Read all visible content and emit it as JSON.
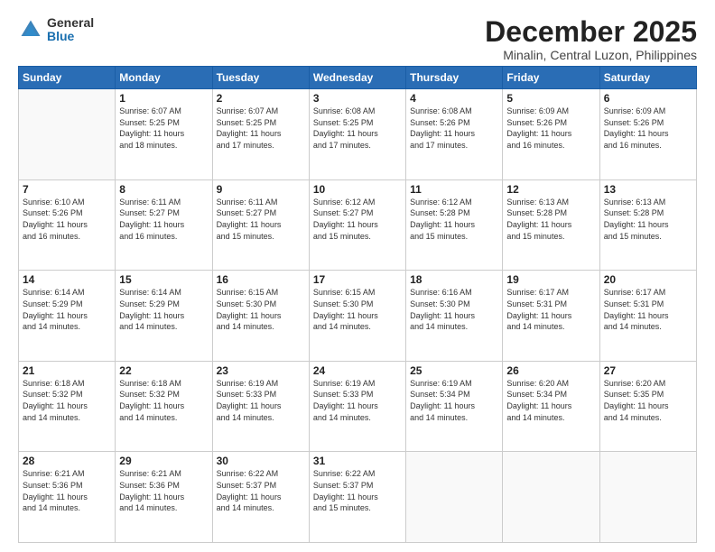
{
  "logo": {
    "general": "General",
    "blue": "Blue"
  },
  "title": "December 2025",
  "subtitle": "Minalin, Central Luzon, Philippines",
  "weekdays": [
    "Sunday",
    "Monday",
    "Tuesday",
    "Wednesday",
    "Thursday",
    "Friday",
    "Saturday"
  ],
  "weeks": [
    [
      {
        "day": "",
        "info": ""
      },
      {
        "day": "1",
        "info": "Sunrise: 6:07 AM\nSunset: 5:25 PM\nDaylight: 11 hours\nand 18 minutes."
      },
      {
        "day": "2",
        "info": "Sunrise: 6:07 AM\nSunset: 5:25 PM\nDaylight: 11 hours\nand 17 minutes."
      },
      {
        "day": "3",
        "info": "Sunrise: 6:08 AM\nSunset: 5:25 PM\nDaylight: 11 hours\nand 17 minutes."
      },
      {
        "day": "4",
        "info": "Sunrise: 6:08 AM\nSunset: 5:26 PM\nDaylight: 11 hours\nand 17 minutes."
      },
      {
        "day": "5",
        "info": "Sunrise: 6:09 AM\nSunset: 5:26 PM\nDaylight: 11 hours\nand 16 minutes."
      },
      {
        "day": "6",
        "info": "Sunrise: 6:09 AM\nSunset: 5:26 PM\nDaylight: 11 hours\nand 16 minutes."
      }
    ],
    [
      {
        "day": "7",
        "info": "Sunrise: 6:10 AM\nSunset: 5:26 PM\nDaylight: 11 hours\nand 16 minutes."
      },
      {
        "day": "8",
        "info": "Sunrise: 6:11 AM\nSunset: 5:27 PM\nDaylight: 11 hours\nand 16 minutes."
      },
      {
        "day": "9",
        "info": "Sunrise: 6:11 AM\nSunset: 5:27 PM\nDaylight: 11 hours\nand 15 minutes."
      },
      {
        "day": "10",
        "info": "Sunrise: 6:12 AM\nSunset: 5:27 PM\nDaylight: 11 hours\nand 15 minutes."
      },
      {
        "day": "11",
        "info": "Sunrise: 6:12 AM\nSunset: 5:28 PM\nDaylight: 11 hours\nand 15 minutes."
      },
      {
        "day": "12",
        "info": "Sunrise: 6:13 AM\nSunset: 5:28 PM\nDaylight: 11 hours\nand 15 minutes."
      },
      {
        "day": "13",
        "info": "Sunrise: 6:13 AM\nSunset: 5:28 PM\nDaylight: 11 hours\nand 15 minutes."
      }
    ],
    [
      {
        "day": "14",
        "info": "Sunrise: 6:14 AM\nSunset: 5:29 PM\nDaylight: 11 hours\nand 14 minutes."
      },
      {
        "day": "15",
        "info": "Sunrise: 6:14 AM\nSunset: 5:29 PM\nDaylight: 11 hours\nand 14 minutes."
      },
      {
        "day": "16",
        "info": "Sunrise: 6:15 AM\nSunset: 5:30 PM\nDaylight: 11 hours\nand 14 minutes."
      },
      {
        "day": "17",
        "info": "Sunrise: 6:15 AM\nSunset: 5:30 PM\nDaylight: 11 hours\nand 14 minutes."
      },
      {
        "day": "18",
        "info": "Sunrise: 6:16 AM\nSunset: 5:30 PM\nDaylight: 11 hours\nand 14 minutes."
      },
      {
        "day": "19",
        "info": "Sunrise: 6:17 AM\nSunset: 5:31 PM\nDaylight: 11 hours\nand 14 minutes."
      },
      {
        "day": "20",
        "info": "Sunrise: 6:17 AM\nSunset: 5:31 PM\nDaylight: 11 hours\nand 14 minutes."
      }
    ],
    [
      {
        "day": "21",
        "info": "Sunrise: 6:18 AM\nSunset: 5:32 PM\nDaylight: 11 hours\nand 14 minutes."
      },
      {
        "day": "22",
        "info": "Sunrise: 6:18 AM\nSunset: 5:32 PM\nDaylight: 11 hours\nand 14 minutes."
      },
      {
        "day": "23",
        "info": "Sunrise: 6:19 AM\nSunset: 5:33 PM\nDaylight: 11 hours\nand 14 minutes."
      },
      {
        "day": "24",
        "info": "Sunrise: 6:19 AM\nSunset: 5:33 PM\nDaylight: 11 hours\nand 14 minutes."
      },
      {
        "day": "25",
        "info": "Sunrise: 6:19 AM\nSunset: 5:34 PM\nDaylight: 11 hours\nand 14 minutes."
      },
      {
        "day": "26",
        "info": "Sunrise: 6:20 AM\nSunset: 5:34 PM\nDaylight: 11 hours\nand 14 minutes."
      },
      {
        "day": "27",
        "info": "Sunrise: 6:20 AM\nSunset: 5:35 PM\nDaylight: 11 hours\nand 14 minutes."
      }
    ],
    [
      {
        "day": "28",
        "info": "Sunrise: 6:21 AM\nSunset: 5:36 PM\nDaylight: 11 hours\nand 14 minutes."
      },
      {
        "day": "29",
        "info": "Sunrise: 6:21 AM\nSunset: 5:36 PM\nDaylight: 11 hours\nand 14 minutes."
      },
      {
        "day": "30",
        "info": "Sunrise: 6:22 AM\nSunset: 5:37 PM\nDaylight: 11 hours\nand 14 minutes."
      },
      {
        "day": "31",
        "info": "Sunrise: 6:22 AM\nSunset: 5:37 PM\nDaylight: 11 hours\nand 15 minutes."
      },
      {
        "day": "",
        "info": ""
      },
      {
        "day": "",
        "info": ""
      },
      {
        "day": "",
        "info": ""
      }
    ]
  ]
}
